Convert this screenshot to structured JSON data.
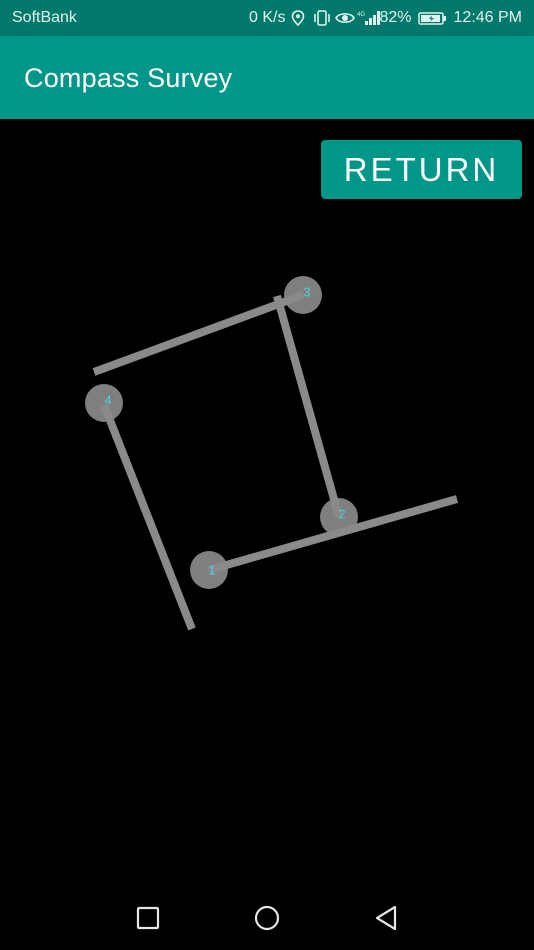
{
  "status_bar": {
    "carrier": "SoftBank",
    "speed": "0 K/s",
    "battery": "82%",
    "time": "12:46 PM",
    "icons": [
      "location-icon",
      "vibrate-icon",
      "eye-icon",
      "signal-4g-icon",
      "battery-icon"
    ]
  },
  "app_bar": {
    "title": "Compass Survey"
  },
  "actions": {
    "return_label": "RETURN"
  },
  "survey": {
    "points": [
      {
        "label": "1"
      },
      {
        "label": "2"
      },
      {
        "label": "3"
      },
      {
        "label": "4"
      }
    ],
    "colors": {
      "line": "#8a8a8a",
      "marker": "#8a8a8a",
      "marker_label": "#4dd0e1",
      "background": "#000000"
    }
  },
  "nav_bar": {
    "icons": [
      "recents-square-icon",
      "home-circle-icon",
      "back-triangle-icon"
    ]
  },
  "colors": {
    "status_bar": "#00796b",
    "app_bar": "#009688",
    "accent": "#009688"
  }
}
